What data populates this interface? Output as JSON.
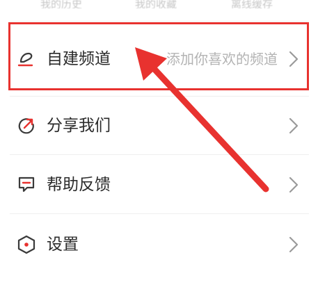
{
  "top_tabs": [
    "我的历史",
    "我的收藏",
    "离线缓存"
  ],
  "menu": {
    "items": [
      {
        "label": "自建频道",
        "hint": "添加你喜欢的频道",
        "icon": "custom-channel-icon"
      },
      {
        "label": "分享我们",
        "hint": "",
        "icon": "share-icon"
      },
      {
        "label": "帮助反馈",
        "hint": "",
        "icon": "feedback-icon"
      },
      {
        "label": "设置",
        "hint": "",
        "icon": "settings-icon"
      }
    ]
  },
  "annotation": {
    "highlight_color": "#e8322f",
    "arrow_color": "#e8322f"
  },
  "colors": {
    "accent": "#e8322f",
    "label": "#2b2b2b",
    "hint": "#b3b3b3",
    "icon": "#3a3a3a",
    "chevron": "#9a9a9a"
  }
}
